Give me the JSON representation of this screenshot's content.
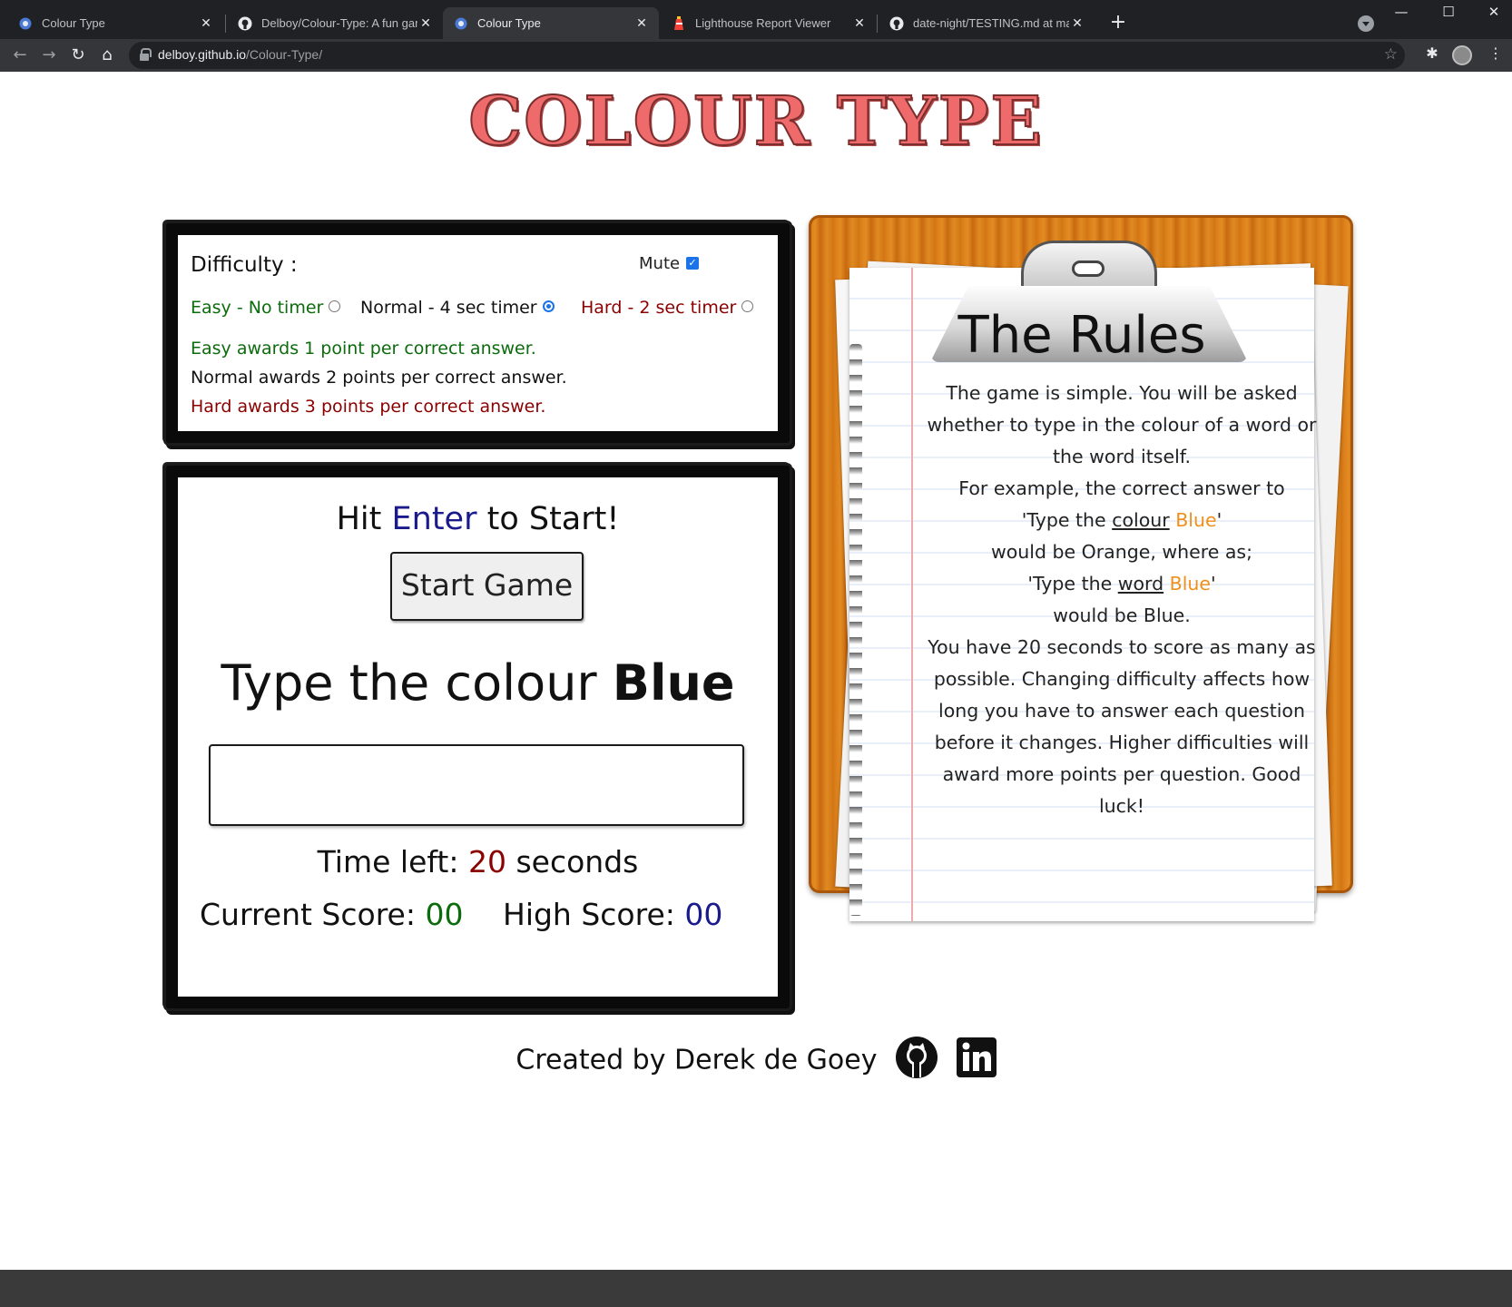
{
  "browser": {
    "tabs": [
      {
        "title": "Colour Type",
        "icon": "chrome-favicon",
        "active": false
      },
      {
        "title": "Delboy/Colour-Type: A fun game",
        "icon": "github-icon",
        "active": false
      },
      {
        "title": "Colour Type",
        "icon": "chrome-favicon",
        "active": true
      },
      {
        "title": "Lighthouse Report Viewer",
        "icon": "lighthouse-icon",
        "active": false
      },
      {
        "title": "date-night/TESTING.md at maste",
        "icon": "github-icon",
        "active": false
      }
    ],
    "url_host": "delboy.github.io",
    "url_path": "/Colour-Type/"
  },
  "page": {
    "title": "COLOUR TYPE",
    "difficulty": {
      "label": "Difficulty :",
      "mute_label": "Mute",
      "mute_checked": true,
      "options": [
        {
          "label": "Easy - No timer",
          "selected": false
        },
        {
          "label": "Normal - 4 sec timer",
          "selected": true
        },
        {
          "label": "Hard - 2 sec timer",
          "selected": false
        }
      ],
      "awards": [
        "Easy awards 1 point per correct answer.",
        "Normal awards 2 points per correct answer.",
        "Hard awards 3 points per correct answer."
      ]
    },
    "game": {
      "hit_prefix": "Hit ",
      "hit_key": "Enter",
      "hit_suffix": " to Start!",
      "start_button": "Start Game",
      "question_prefix": "Type the colour ",
      "question_word": "Blue",
      "answer_value": "",
      "time_prefix": "Time left: ",
      "time_value": "20",
      "time_suffix": " seconds",
      "current_score_label": "Current Score: ",
      "current_score": "00",
      "high_score_label": "High Score: ",
      "high_score": "00"
    },
    "rules": {
      "title": "The Rules",
      "p1": "The game is simple. You will be asked whether to type in the colour of a word or the word itself.",
      "p2": "For example, the correct answer to",
      "ex1_a": "'Type the ",
      "ex1_u": "colour",
      "ex1_sp": " ",
      "ex1_word": "Blue",
      "ex1_end": "'",
      "ex1_answer": "would be Orange, where as;",
      "ex2_a": "'Type the ",
      "ex2_u": "word",
      "ex2_sp": " ",
      "ex2_word": "Blue",
      "ex2_end": "'",
      "ex2_answer": "would be Blue.",
      "p3": "You have 20 seconds to score as many as possible. Changing difficulty affects how long you have to answer each question before it changes. Higher difficulties will award more points per question. Good luck!"
    },
    "footer": {
      "text": "Created by Derek de Goey"
    }
  }
}
